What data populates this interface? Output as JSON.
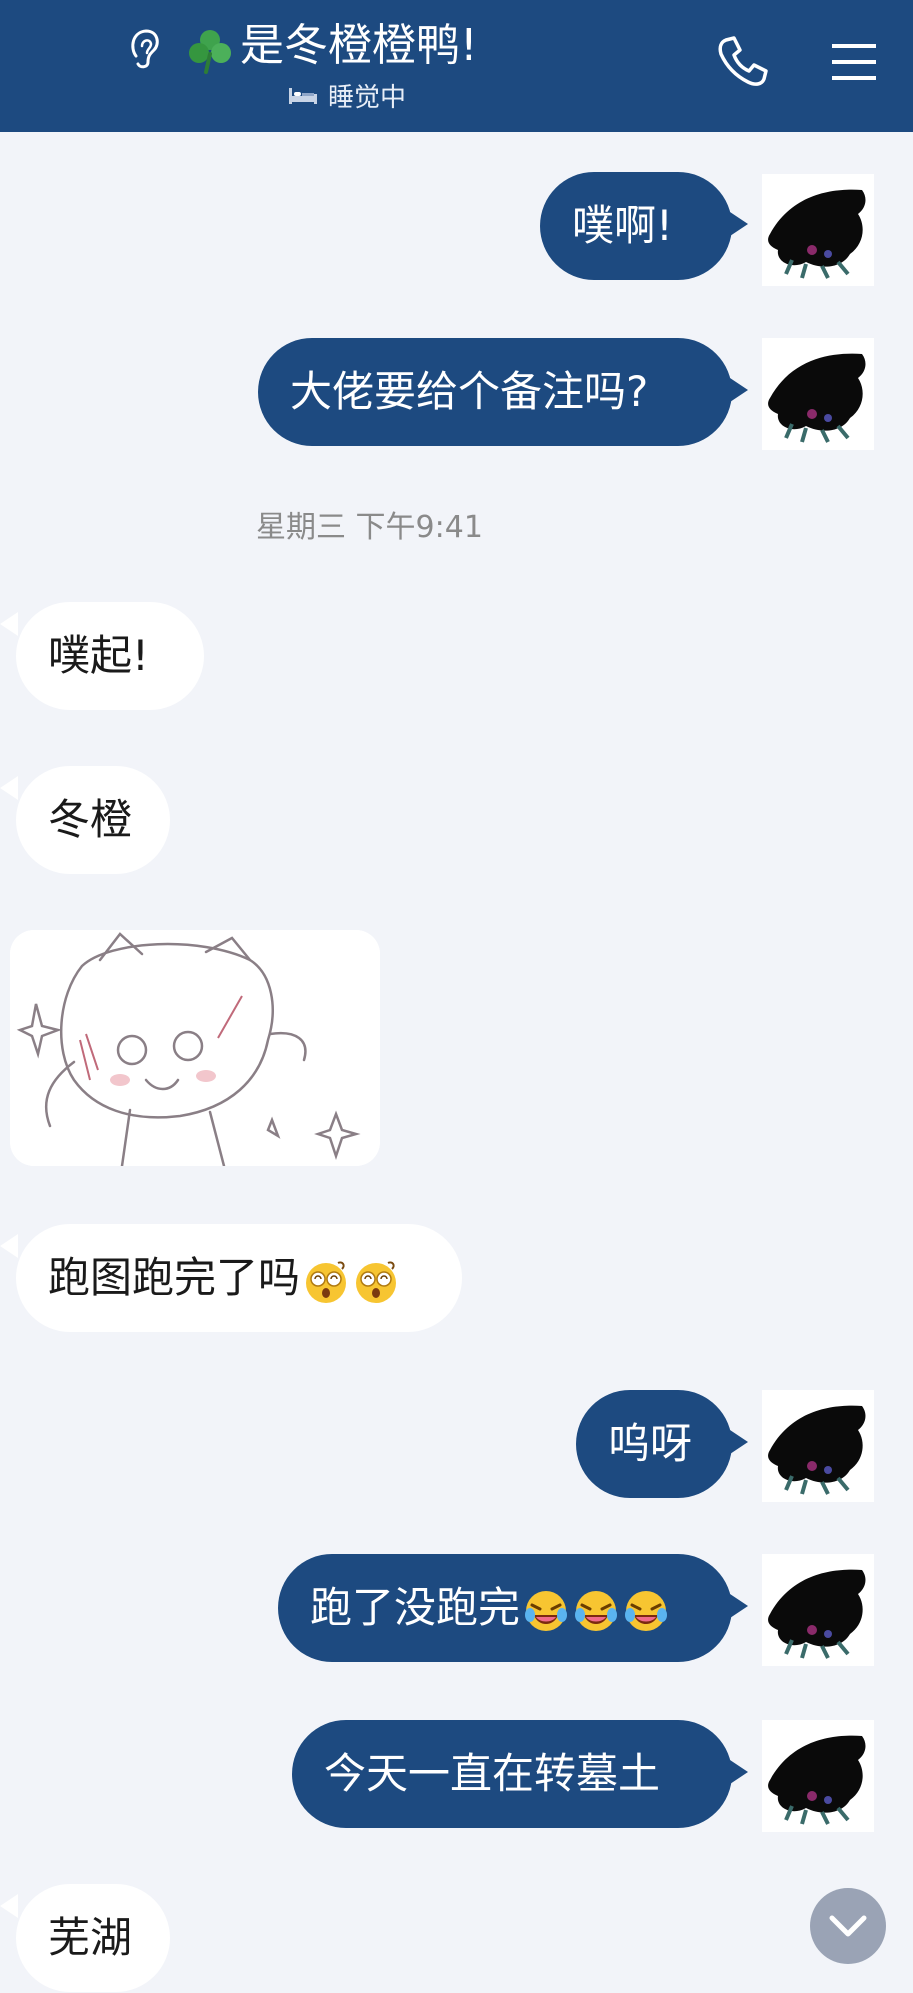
{
  "header": {
    "title": "是冬橙橙鸭!",
    "status_text": "睡觉中",
    "icons": [
      "ear-icon",
      "clover-icon",
      "bed-icon",
      "phone-icon",
      "menu-icon"
    ]
  },
  "messages": [
    {
      "side": "out",
      "text": "噗啊!"
    },
    {
      "side": "out",
      "text": "大佬要给个备注吗?"
    },
    {
      "side": "in",
      "text": "噗起!"
    },
    {
      "side": "in",
      "text": "冬橙"
    },
    {
      "side": "in",
      "type": "image",
      "description": "sticker"
    },
    {
      "side": "in",
      "text": "跑图跑完了吗",
      "emoji": "dizzy-face-emoji",
      "emoji_count": 2
    },
    {
      "side": "out",
      "text": "呜呀"
    },
    {
      "side": "out",
      "text": "跑了没跑完",
      "emoji": "laughing-crying-emoji",
      "emoji_count": 3
    },
    {
      "side": "out",
      "text": "今天一直在转墓土"
    },
    {
      "side": "in",
      "text": "芜湖"
    }
  ],
  "timestamp": "星期三 下午9:41",
  "colors": {
    "header_bg": "#1d4a80",
    "outgoing_bubble": "#1d4a80",
    "incoming_bubble": "#ffffff",
    "page_bg": "#f2f4f9"
  }
}
